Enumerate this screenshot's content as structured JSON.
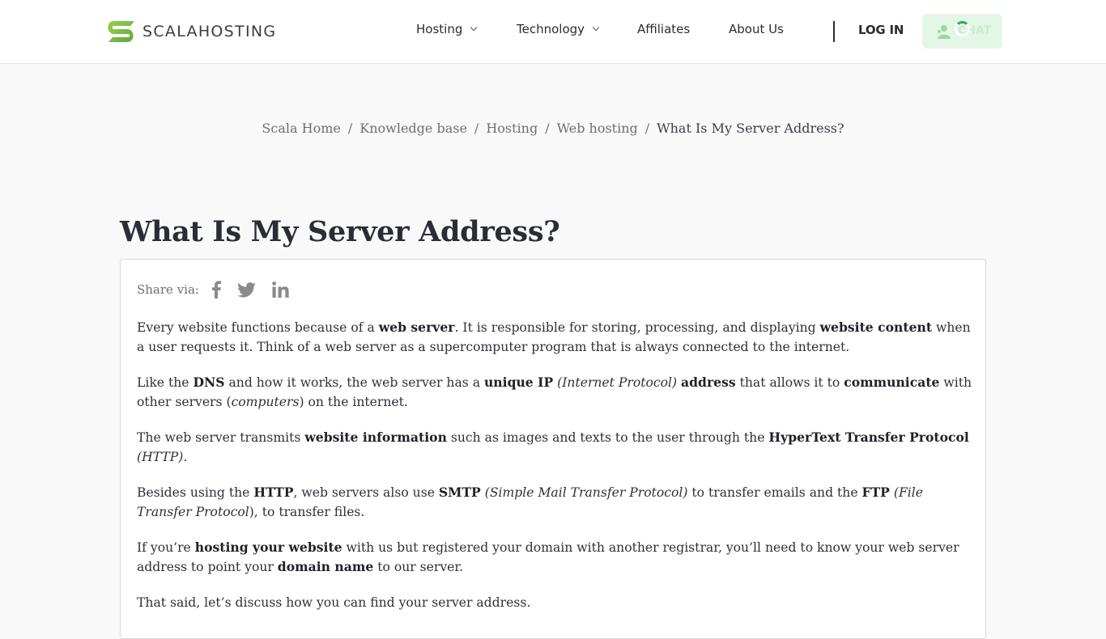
{
  "header": {
    "logo_text": "SCALAHOSTING",
    "logo_icon": "scala-s-logo-icon",
    "brand_color": "#7cc242",
    "nav": [
      {
        "label": "Hosting",
        "has_dropdown": true
      },
      {
        "label": "Technology",
        "has_dropdown": true
      },
      {
        "label": "Affiliates",
        "has_dropdown": false
      },
      {
        "label": "About Us",
        "has_dropdown": false
      }
    ],
    "login_label": "LOG IN",
    "chat_label": "CHAT",
    "chat_icon": "user-chat-icon",
    "chat_state": "loading"
  },
  "breadcrumb": {
    "items": [
      "Scala Home",
      "Knowledge base",
      "Hosting",
      "Web hosting"
    ],
    "separator": "/",
    "current": "What Is My Server Address?"
  },
  "article": {
    "title": "What Is My Server Address?",
    "share_label": "Share via:",
    "share_icons": [
      "facebook-icon",
      "twitter-icon",
      "linkedin-icon"
    ],
    "paragraphs": [
      [
        {
          "t": "Every website functions because of a "
        },
        {
          "t": "web server",
          "b": true
        },
        {
          "t": ". It is responsible for storing, processing, and displaying "
        },
        {
          "t": "website content",
          "b": true
        },
        {
          "t": " when a user requests it. Think of a web server as a supercomputer program that is always connected to the internet."
        }
      ],
      [
        {
          "t": "Like the "
        },
        {
          "t": "DNS",
          "b": true
        },
        {
          "t": " and how it works, the web server has a "
        },
        {
          "t": "unique IP",
          "b": true
        },
        {
          "t": " "
        },
        {
          "t": "(Internet Protocol)",
          "i": true
        },
        {
          "t": " "
        },
        {
          "t": "address",
          "b": true
        },
        {
          "t": " that allows it to "
        },
        {
          "t": "communicate",
          "b": true
        },
        {
          "t": " with other servers ("
        },
        {
          "t": "computers",
          "i": true
        },
        {
          "t": ") on the internet."
        }
      ],
      [
        {
          "t": "The web server transmits "
        },
        {
          "t": "website information",
          "b": true
        },
        {
          "t": " such as images and texts to the user through the "
        },
        {
          "t": "HyperText Transfer Protocol",
          "b": true
        },
        {
          "t": " "
        },
        {
          "t": "(HTTP).",
          "i": true
        }
      ],
      [
        {
          "t": "Besides using the "
        },
        {
          "t": "HTTP",
          "b": true
        },
        {
          "t": ", web servers also use "
        },
        {
          "t": "SMTP",
          "b": true
        },
        {
          "t": " "
        },
        {
          "t": "(Simple Mail Transfer Protocol)",
          "i": true
        },
        {
          "t": " to transfer emails and the "
        },
        {
          "t": "FTP",
          "b": true
        },
        {
          "t": " "
        },
        {
          "t": "(File Transfer Protocol",
          "i": true
        },
        {
          "t": "), to transfer files."
        }
      ],
      [
        {
          "t": "If you’re "
        },
        {
          "t": "hosting your website",
          "b": true
        },
        {
          "t": " with us but registered your domain with another registrar, you’ll need to know your web server address to point your "
        },
        {
          "t": "domain name",
          "b": true
        },
        {
          "t": " to our server."
        }
      ],
      [
        {
          "t": "That said, let’s discuss how you can find your server address."
        }
      ]
    ]
  }
}
